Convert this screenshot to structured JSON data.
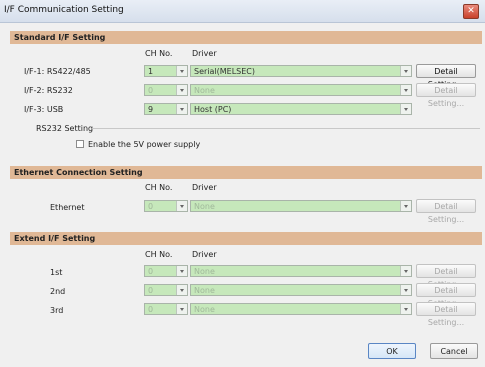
{
  "window": {
    "title": "I/F Communication Setting",
    "close_icon": "close-icon"
  },
  "standard": {
    "header": "Standard I/F Setting",
    "col_ch": "CH No.",
    "col_driver": "Driver",
    "rows": [
      {
        "label": "I/F-1:  RS422/485",
        "ch": "1",
        "driver": "Serial(MELSEC)",
        "button": "Detail Setting...",
        "enabled": true
      },
      {
        "label": "I/F-2:  RS232",
        "ch": "0",
        "driver": "None",
        "button": "Detail Setting...",
        "enabled": false
      },
      {
        "label": "I/F-3:  USB",
        "ch": "9",
        "driver": "Host (PC)",
        "enabled": true
      }
    ],
    "rs232_group": "RS232 Setting",
    "power_checkbox": "Enable the 5V power supply"
  },
  "ethernet": {
    "header": "Ethernet Connection Setting",
    "col_ch": "CH No.",
    "col_driver": "Driver",
    "rows": [
      {
        "label": "Ethernet",
        "ch": "0",
        "driver": "None",
        "button": "Detail Setting..."
      }
    ]
  },
  "extend": {
    "header": "Extend I/F Setting",
    "col_ch": "CH No.",
    "col_driver": "Driver",
    "rows": [
      {
        "label": "1st",
        "ch": "0",
        "driver": "None",
        "button": "Detail Setting..."
      },
      {
        "label": "2nd",
        "ch": "0",
        "driver": "None",
        "button": "Detail Setting..."
      },
      {
        "label": "3rd",
        "ch": "0",
        "driver": "None",
        "button": "Detail Setting..."
      }
    ]
  },
  "footer": {
    "ok": "OK",
    "cancel": "Cancel"
  }
}
